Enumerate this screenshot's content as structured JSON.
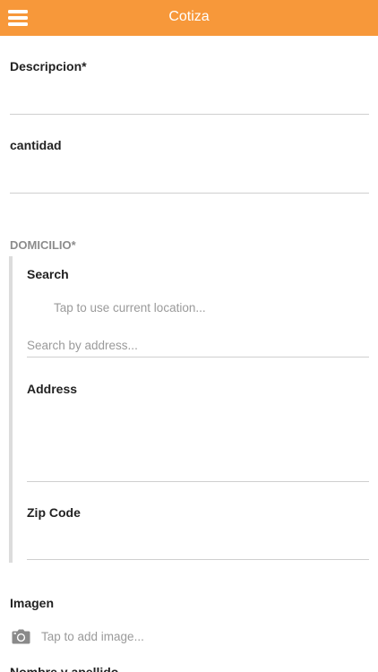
{
  "header": {
    "title": "Cotiza",
    "menu_icon": "hamburger-menu-icon",
    "background_color": "#f7983a"
  },
  "form": {
    "descripcion_label": "Descripcion*",
    "cantidad_label": "cantidad",
    "domicilio": {
      "label": "DOMICILIO*",
      "search_label": "Search",
      "current_location_text": "Tap to use current location...",
      "search_placeholder": "Search by address...",
      "address_label": "Address",
      "zip_label": "Zip Code"
    },
    "imagen": {
      "label": "Imagen",
      "icon": "camera-icon",
      "tap_text": "Tap to add image..."
    },
    "next_label_partial": "Nombre y apellido"
  }
}
